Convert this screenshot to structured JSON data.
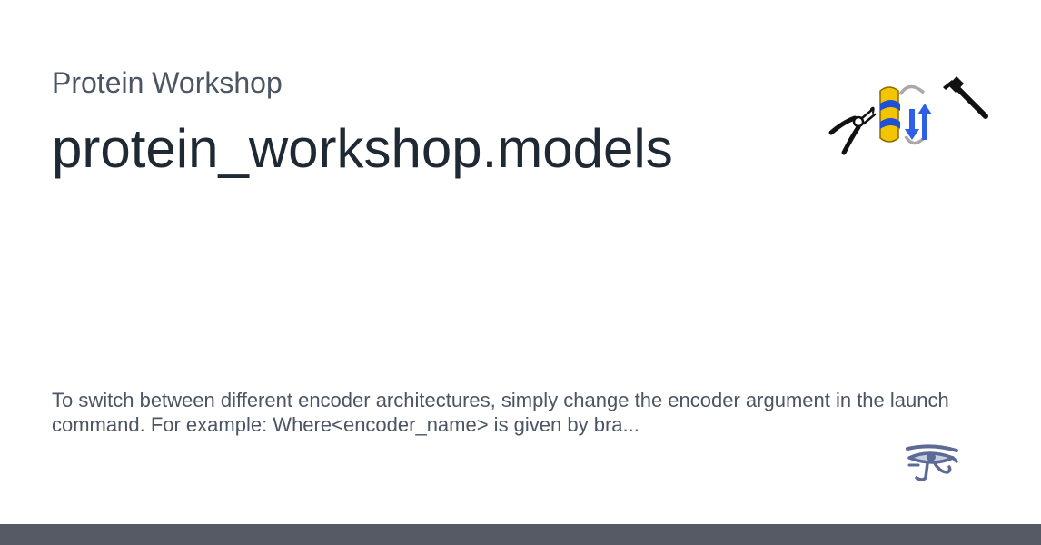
{
  "card": {
    "site_name": "Protein Workshop",
    "title": "protein_workshop.models",
    "description": "To switch between different encoder architectures, simply change the encoder argument in the launch command. For example: Where<encoder_name> is given by bra..."
  },
  "logo": {
    "icons": [
      "pliers-icon",
      "protein-helix-icon",
      "beta-strand-arrows-icon",
      "hammer-icon"
    ]
  },
  "brand_icon": "eye-of-horus-icon",
  "colors": {
    "background": "#ffffff",
    "site_name": "#4b5563",
    "title": "#1f2933",
    "description": "#4b5563",
    "footer_bar": "#555a65",
    "helix_yellow": "#f5c400",
    "helix_blue": "#1d4fd8",
    "brand_icon": "#5b6b96"
  }
}
